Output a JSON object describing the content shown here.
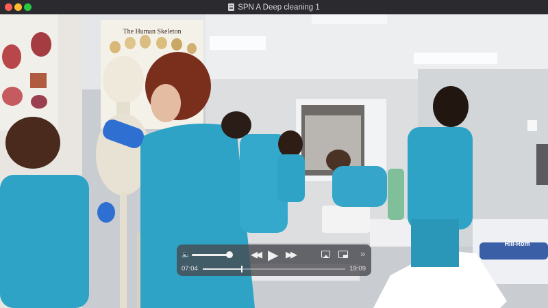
{
  "window": {
    "title": "SPN A Deep cleaning 1"
  },
  "player": {
    "time_elapsed": "07:04",
    "time_remaining": "19:09",
    "volume_level": 0.95,
    "playback_progress": 0.27
  },
  "poster": {
    "title": "The Human Skeleton"
  },
  "bed": {
    "brand": "Hill-Rom"
  },
  "icons": {
    "volume": "speaker-icon",
    "rewind": "rewind-icon",
    "play": "play-icon",
    "fast_forward": "fast-forward-icon",
    "airplay": "airplay-icon",
    "pip": "picture-in-picture-icon",
    "more": "chevrons-right-icon",
    "document": "document-icon"
  },
  "colors": {
    "scrubs": "#2fa3c6",
    "gloves": "#2e6fd1",
    "titlebar": "#2b2a2f"
  }
}
